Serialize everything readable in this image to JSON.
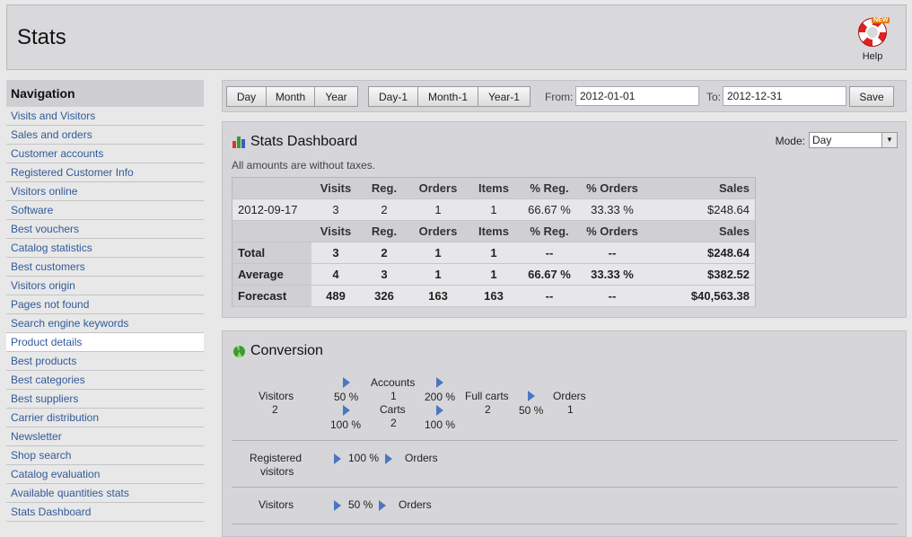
{
  "header": {
    "title": "Stats",
    "help_label": "Help",
    "help_badge": "NEW"
  },
  "sidebar": {
    "title": "Navigation",
    "active_index": 12,
    "items": [
      "Visits and Visitors",
      "Sales and orders",
      "Customer accounts",
      "Registered Customer Info",
      "Visitors online",
      "Software",
      "Best vouchers",
      "Catalog statistics",
      "Best customers",
      "Visitors origin",
      "Pages not found",
      "Search engine keywords",
      "Product details",
      "Best products",
      "Best categories",
      "Best suppliers",
      "Carrier distribution",
      "Newsletter",
      "Shop search",
      "Catalog evaluation",
      "Available quantities stats",
      "Stats Dashboard"
    ]
  },
  "toolbar": {
    "day": "Day",
    "month": "Month",
    "year": "Year",
    "day_prev": "Day-1",
    "month_prev": "Month-1",
    "year_prev": "Year-1",
    "from_label": "From:",
    "from_value": "2012-01-01",
    "to_label": "To:",
    "to_value": "2012-12-31",
    "save": "Save"
  },
  "dashboard": {
    "title": "Stats Dashboard",
    "mode_label": "Mode:",
    "mode_value": "Day",
    "note": "All amounts are without taxes.",
    "columns": [
      "",
      "Visits",
      "Reg.",
      "Orders",
      "Items",
      "% Reg.",
      "% Orders",
      "Sales"
    ],
    "rows": [
      [
        "2012-09-17",
        "3",
        "2",
        "1",
        "1",
        "66.67 %",
        "33.33 %",
        "$248.64"
      ]
    ],
    "summary": [
      [
        "Total",
        "3",
        "2",
        "1",
        "1",
        "--",
        "--",
        "$248.64"
      ],
      [
        "Average",
        "4",
        "3",
        "1",
        "1",
        "66.67 %",
        "33.33 %",
        "$382.52"
      ],
      [
        "Forecast",
        "489",
        "326",
        "163",
        "163",
        "--",
        "--",
        "$40,563.38"
      ]
    ]
  },
  "conversion": {
    "title": "Conversion",
    "visitors": "Visitors",
    "visitors_count": "2",
    "pct_accounts": "50 %",
    "accounts": "Accounts",
    "accounts_count": "1",
    "pct_accounts_carts": "200 %",
    "pct_carts": "100 %",
    "carts": "Carts",
    "carts_count": "2",
    "pct_carts_full": "100 %",
    "full_carts": "Full carts",
    "full_carts_count": "2",
    "pct_orders": "50 %",
    "orders": "Orders",
    "orders_count": "1",
    "row2_label_1": "Registered",
    "row2_label_2": "visitors",
    "row2_pct": "100 %",
    "row2_orders": "Orders",
    "row3_label": "Visitors",
    "row3_pct": "50 %",
    "row3_orders": "Orders"
  }
}
